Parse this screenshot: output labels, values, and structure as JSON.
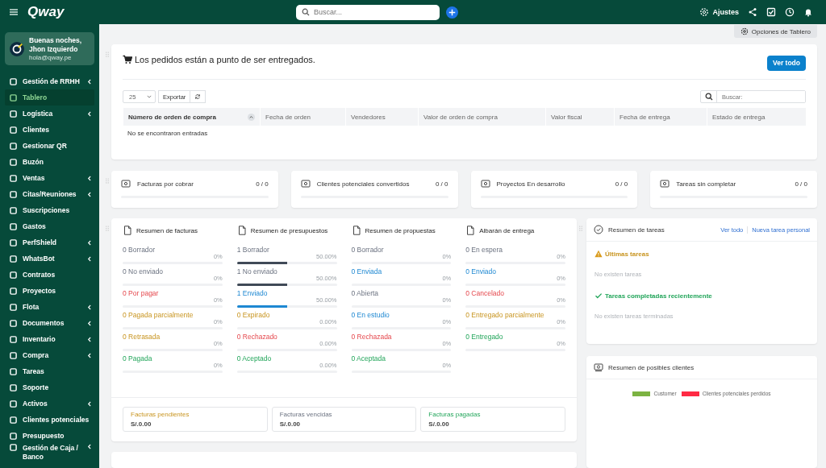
{
  "topbar": {
    "logo": "Qway",
    "search": {
      "placeholder": "Buscar..."
    },
    "settings_label": "Ajustes"
  },
  "user": {
    "greeting": "Buenas noches,",
    "name": "Jhon Izquierdo",
    "email": "hola@qway.pe"
  },
  "sidebar": {
    "items": [
      {
        "label": "Gestión de RRHH",
        "selected": false,
        "submenu": true
      },
      {
        "label": "Tablero",
        "selected": true,
        "submenu": false
      },
      {
        "label": "Logística",
        "selected": false,
        "submenu": true
      },
      {
        "label": "Clientes",
        "selected": false,
        "submenu": false
      },
      {
        "label": "Gestionar QR",
        "selected": false,
        "submenu": false
      },
      {
        "label": "Buzón",
        "selected": false,
        "submenu": false
      },
      {
        "label": "Ventas",
        "selected": false,
        "submenu": true
      },
      {
        "label": "Citas/Reuniones",
        "selected": false,
        "submenu": true
      },
      {
        "label": "Suscripciones",
        "selected": false,
        "submenu": false
      },
      {
        "label": "Gastos",
        "selected": false,
        "submenu": false
      },
      {
        "label": "PerfShield",
        "selected": false,
        "submenu": true
      },
      {
        "label": "WhatsBot",
        "selected": false,
        "submenu": true
      },
      {
        "label": "Contratos",
        "selected": false,
        "submenu": false
      },
      {
        "label": "Proyectos",
        "selected": false,
        "submenu": false
      },
      {
        "label": "Flota",
        "selected": false,
        "submenu": true
      },
      {
        "label": "Documentos",
        "selected": false,
        "submenu": true
      },
      {
        "label": "Inventario",
        "selected": false,
        "submenu": true
      },
      {
        "label": "Compra",
        "selected": false,
        "submenu": true
      },
      {
        "label": "Tareas",
        "selected": false,
        "submenu": false
      },
      {
        "label": "Soporte",
        "selected": false,
        "submenu": false
      },
      {
        "label": "Activos",
        "selected": false,
        "submenu": true
      },
      {
        "label": "Clientes potenciales",
        "selected": false,
        "submenu": false
      },
      {
        "label": "Presupuesto",
        "selected": false,
        "submenu": false
      },
      {
        "label": "Gestión de Caja / Banco",
        "selected": false,
        "submenu": true
      }
    ]
  },
  "dashboard_options": "Opciones de Tablero",
  "orders": {
    "title": "Los pedidos están a punto de ser entregados.",
    "view_all": "Ver todo",
    "page_size": "25",
    "export": "Exportar",
    "search_placeholder": "Buscar:",
    "columns": [
      "Número de orden de compra",
      "Fecha de orden",
      "Vendedores",
      "Valor de orden de compra",
      "Valor fiscal",
      "Fecha de entrega",
      "Estado de entrega"
    ],
    "empty": "No se encontraron entradas"
  },
  "stats": [
    {
      "label": "Facturas por cobrar",
      "value": "0 / 0",
      "level": 0
    },
    {
      "label": "Clientes potenciales convertidos",
      "value": "0 / 0",
      "level": 0
    },
    {
      "label": "Proyectos En desarrollo",
      "value": "0 / 0",
      "level": 0
    },
    {
      "label": "Tareas sin completar",
      "value": "0 / 0",
      "level": 0
    }
  ],
  "summaries": [
    {
      "title": "Resumen de facturas",
      "items": [
        {
          "label": "0 Borrador",
          "percent": "0%",
          "level": 0,
          "kind": "muted"
        },
        {
          "label": "0 No enviado",
          "percent": "0%",
          "level": 0,
          "kind": "muted"
        },
        {
          "label": "0 Por pagar",
          "percent": "0%",
          "level": 0,
          "kind": "danger"
        },
        {
          "label": "0 Pagada parcialmente",
          "percent": "0%",
          "level": 0,
          "kind": "warning"
        },
        {
          "label": "0 Retrasada",
          "percent": "0%",
          "level": 0,
          "kind": "warning"
        },
        {
          "label": "0 Pagada",
          "percent": "0%",
          "level": 0,
          "kind": "success"
        }
      ]
    },
    {
      "title": "Resumen de presupuestos",
      "items": [
        {
          "label": "1 Borrador",
          "percent": "50.00%",
          "level": 0.5,
          "kind": "dark"
        },
        {
          "label": "1 No enviado",
          "percent": "50.00%",
          "level": 0.5,
          "kind": "dark"
        },
        {
          "label": "1 Enviado",
          "percent": "50.00%",
          "level": 0.5,
          "kind": "info"
        },
        {
          "label": "0 Expirado",
          "percent": "0.00%",
          "level": 0,
          "kind": "warning"
        },
        {
          "label": "0 Rechazado",
          "percent": "0.00%",
          "level": 0,
          "kind": "danger"
        },
        {
          "label": "0 Aceptado",
          "percent": "0.00%",
          "level": 0,
          "kind": "success"
        }
      ]
    },
    {
      "title": "Resumen de propuestas",
      "items": [
        {
          "label": "0 Borrador",
          "percent": "0%",
          "level": 0,
          "kind": "muted"
        },
        {
          "label": "0 Enviada",
          "percent": "0%",
          "level": 0,
          "kind": "info"
        },
        {
          "label": "0 Abierta",
          "percent": "0%",
          "level": 0,
          "kind": "muted"
        },
        {
          "label": "0 En estudio",
          "percent": "0%",
          "level": 0,
          "kind": "info"
        },
        {
          "label": "0 Rechazada",
          "percent": "0%",
          "level": 0,
          "kind": "danger"
        },
        {
          "label": "0 Aceptada",
          "percent": "0%",
          "level": 0,
          "kind": "success"
        }
      ]
    },
    {
      "title": "Albarán de entrega",
      "items": [
        {
          "label": "0 En espera",
          "percent": "0%",
          "level": 0,
          "kind": "muted"
        },
        {
          "label": "0 Enviado",
          "percent": "0%",
          "level": 0,
          "kind": "info"
        },
        {
          "label": "0 Cancelado",
          "percent": "0%",
          "level": 0,
          "kind": "danger"
        },
        {
          "label": "0 Entregado parcialmente",
          "percent": "0%",
          "level": 0,
          "kind": "warning"
        },
        {
          "label": "0 Entregado",
          "percent": "0%",
          "level": 0,
          "kind": "success"
        }
      ]
    }
  ],
  "totals": [
    {
      "label": "Facturas pendientes",
      "amount": "S/.0.00",
      "kind": "warning"
    },
    {
      "label": "Facturas vencidas",
      "amount": "S/.0.00",
      "kind": "muted"
    },
    {
      "label": "Facturas pagadas",
      "amount": "S/.0.00",
      "kind": "success"
    }
  ],
  "tasks": {
    "title": "Resumen de tareas",
    "links": [
      "Ver todo",
      "Nueva tarea personal"
    ],
    "sections": [
      {
        "kind": "warning",
        "title": "Últimas tareas",
        "empty": "No existen tareas"
      },
      {
        "kind": "done",
        "title": "Tareas completadas recientemente",
        "empty": "No existen tareas terminadas"
      }
    ]
  },
  "leads": {
    "title": "Resumen de posibles clientes",
    "legend": [
      {
        "label": "Customer",
        "color": "#7cb342"
      },
      {
        "label": "Clientes potenciales perdidos",
        "color": "#ff2a44"
      }
    ]
  }
}
